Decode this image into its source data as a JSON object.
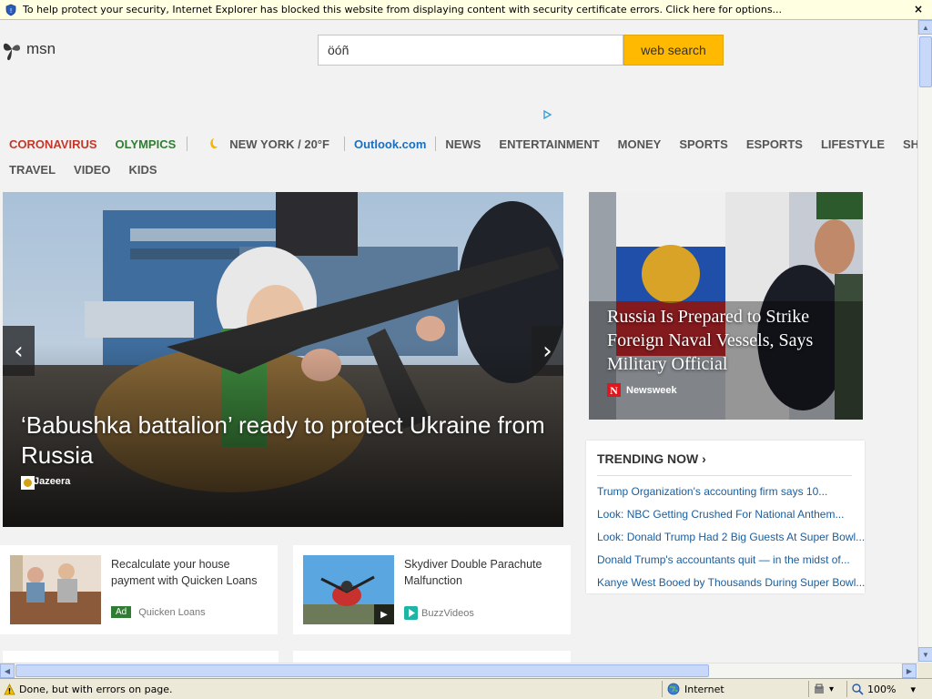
{
  "infobar": {
    "message": "To help protect your security, Internet Explorer has blocked this website from displaying content with security certificate errors. Click here for options...",
    "close": "×"
  },
  "header": {
    "logo_text": "msn",
    "search_value": "öóñ",
    "search_button": "web search"
  },
  "nav": {
    "row1": [
      {
        "label": "CORONAVIRUS",
        "color": "#c0392b"
      },
      {
        "label": "OLYMPICS",
        "color": "#2e7d32"
      }
    ],
    "weather": "NEW YORK / 20°F",
    "outlook": "Outlook.com",
    "outlook_color": "#1a6fbf",
    "items": [
      "NEWS",
      "ENTERTAINMENT",
      "MONEY",
      "SPORTS",
      "ESPORTS",
      "LIFESTYLE",
      "SHOPPI"
    ],
    "row2": [
      "TRAVEL",
      "VIDEO",
      "KIDS"
    ]
  },
  "hero": {
    "title": "‘Babushka battalion’ ready to protect Ukraine from Russia",
    "source": "Al Jazeera",
    "prev": "‹",
    "next": "›"
  },
  "side_story": {
    "title": "Russia Is Prepared to Strike Foreign Naval Vessels, Says Military Official",
    "source": "Newsweek"
  },
  "trending": {
    "heading": "TRENDING NOW",
    "chevron": "›",
    "items": [
      "Trump Organization's accounting firm says 10...",
      "Look: NBC Getting Crushed For National Anthem...",
      "Look: Donald Trump Had 2 Big Guests At Super Bowl...",
      "Donald Trump's accountants quit — in the midst of...",
      "Kanye West Booed by Thousands During Super Bowl..."
    ]
  },
  "cards": [
    {
      "title": "Recalculate your house payment with Quicken Loans",
      "badge": "Ad",
      "source": "Quicken Loans"
    },
    {
      "title": "Skydiver Double Parachute Malfunction",
      "source": "BuzzVideos",
      "play": "▶"
    }
  ],
  "scroll": {
    "up": "▲",
    "down": "▼",
    "left": "◀",
    "right": "▶"
  },
  "statusbar": {
    "message": "Done, but with errors on page.",
    "zone": "Internet",
    "zoom": "100%",
    "zoom_arrow": "▾",
    "protected_arrow": "▾"
  }
}
